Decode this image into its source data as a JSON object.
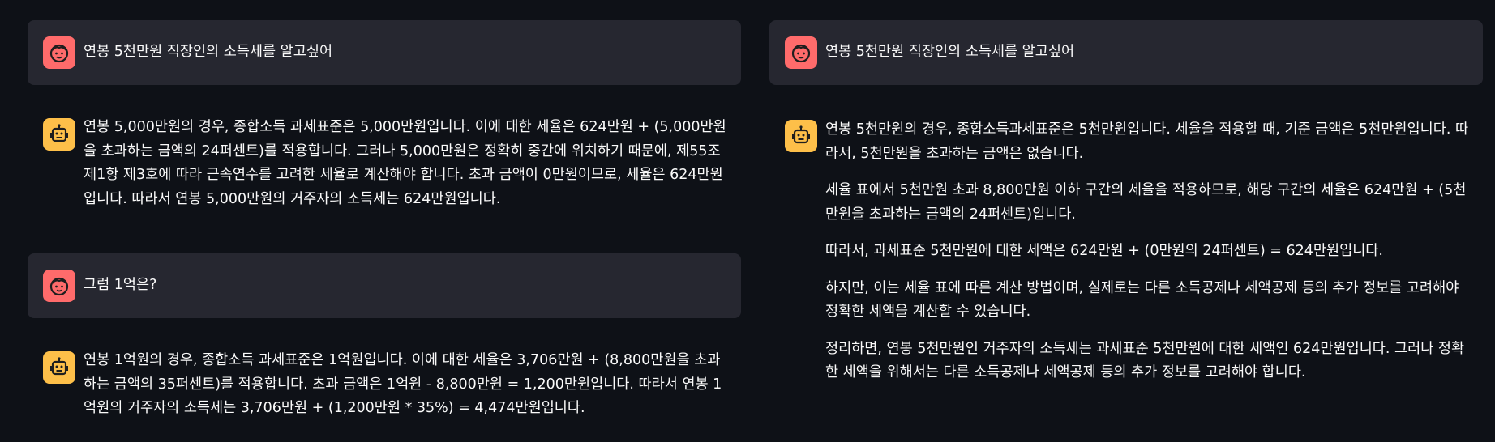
{
  "left_panel": {
    "messages": [
      {
        "role": "user",
        "text": "연봉 5천만원 직장인의 소득세를 알고싶어"
      },
      {
        "role": "assistant",
        "paragraphs": [
          "연봉 5,000만원의 경우, 종합소득 과세표준은 5,000만원입니다. 이에 대한 세율은 624만원 + (5,000만원을 초과하는 금액의 24퍼센트)를 적용합니다. 그러나 5,000만원은 정확히 중간에 위치하기 때문에, 제55조 제1항 제3호에 따라 근속연수를 고려한 세율로 계산해야 합니다. 초과 금액이 0만원이므로, 세율은 624만원입니다. 따라서 연봉 5,000만원의 거주자의 소득세는 624만원입니다."
        ]
      },
      {
        "role": "user",
        "text": "그럼 1억은?"
      },
      {
        "role": "assistant",
        "paragraphs": [
          "연봉 1억원의 경우, 종합소득 과세표준은 1억원입니다. 이에 대한 세율은 3,706만원 + (8,800만원을 초과하는 금액의 35퍼센트)를 적용합니다. 초과 금액은 1억원 - 8,800만원 = 1,200만원입니다. 따라서 연봉 1억원의 거주자의 소득세는 3,706만원 + (1,200만원 * 35%) = 4,474만원입니다."
        ]
      }
    ]
  },
  "right_panel": {
    "messages": [
      {
        "role": "user",
        "text": "연봉 5천만원 직장인의 소득세를 알고싶어"
      },
      {
        "role": "assistant",
        "paragraphs": [
          "연봉 5천만원의 경우, 종합소득과세표준은 5천만원입니다. 세율을 적용할 때, 기준 금액은 5천만원입니다. 따라서, 5천만원을 초과하는 금액은 없습니다.",
          "세율 표에서 5천만원 초과 8,800만원 이하 구간의 세율을 적용하므로, 해당 구간의 세율은 624만원 + (5천만원을 초과하는 금액의 24퍼센트)입니다.",
          "따라서, 과세표준 5천만원에 대한 세액은 624만원 + (0만원의 24퍼센트) = 624만원입니다.",
          "하지만, 이는 세율 표에 따른 계산 방법이며, 실제로는 다른 소득공제나 세액공제 등의 추가 정보를 고려해야 정확한 세액을 계산할 수 있습니다.",
          "정리하면, 연봉 5천만원인 거주자의 소득세는 과세표준 5천만원에 대한 세액인 624만원입니다. 그러나 정확한 세액을 위해서는 다른 소득공제나 세액공제 등의 추가 정보를 고려해야 합니다."
        ]
      }
    ]
  },
  "colors": {
    "background": "#0e1117",
    "user_bubble": "#262730",
    "user_avatar": "#ff6b6b",
    "assistant_avatar": "#fdbf49",
    "text": "#fafafa"
  },
  "icons": {
    "user_avatar": "face-icon",
    "assistant_avatar": "robot-icon"
  }
}
